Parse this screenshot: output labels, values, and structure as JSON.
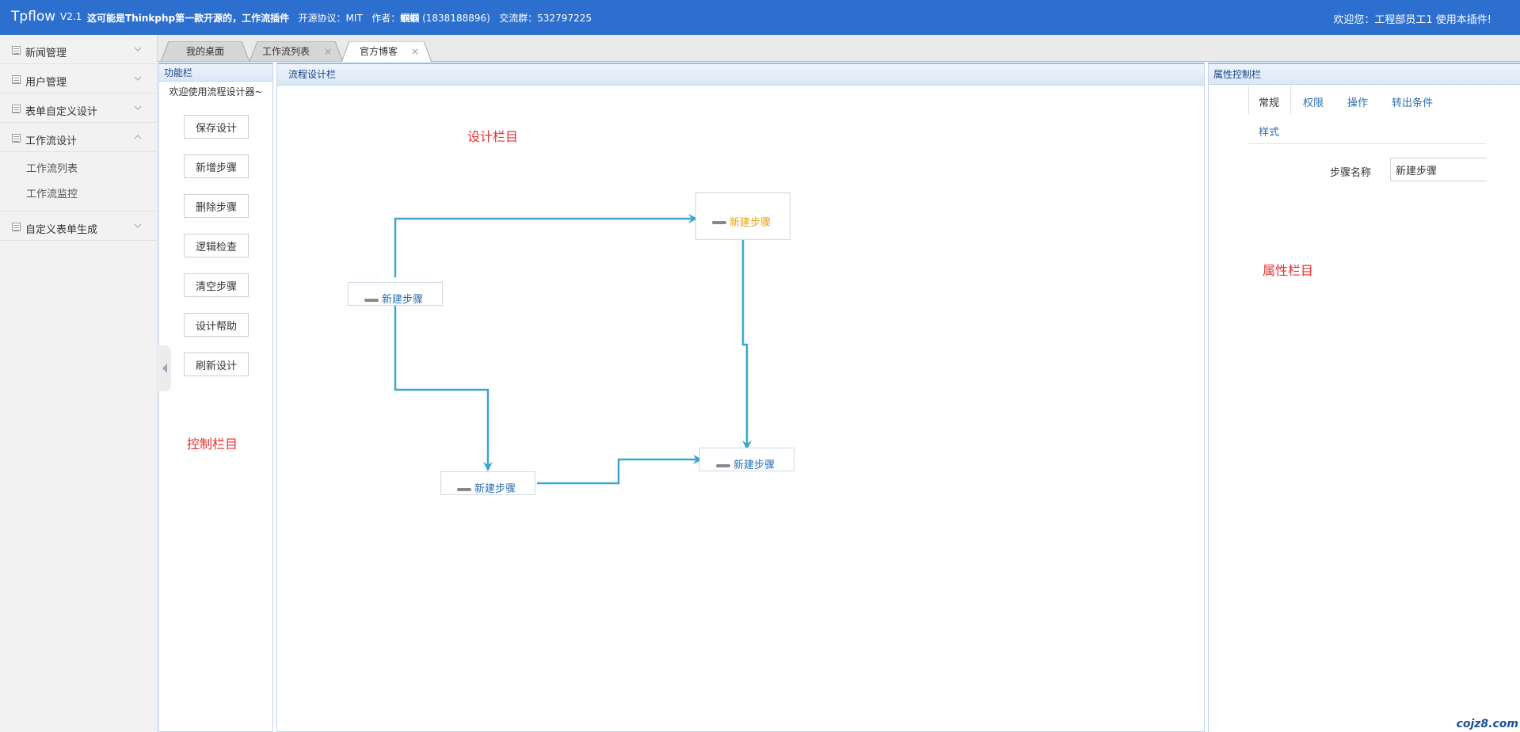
{
  "header": {
    "logo": "Tpflow",
    "version": "V2.1",
    "tagline": "这可能是Thinkphp第一款开源的，工作流插件",
    "license": "开源协议：MIT",
    "author_label": "作者：",
    "author_name": "蝈蝈",
    "author_contact": "(1838188896)",
    "group": "交流群：532797225",
    "welcome": "欢迎您：工程部员工1 使用本插件!"
  },
  "sidebar": {
    "items": [
      {
        "label": "新闻管理",
        "expanded": false
      },
      {
        "label": "用户管理",
        "expanded": false
      },
      {
        "label": "表单自定义设计",
        "expanded": false
      },
      {
        "label": "工作流设计",
        "expanded": true,
        "children": [
          "工作流列表",
          "工作流监控"
        ]
      },
      {
        "label": "自定义表单生成",
        "expanded": false
      }
    ]
  },
  "tabs": [
    {
      "label": "我的桌面",
      "closable": false,
      "active": false
    },
    {
      "label": "工作流列表",
      "closable": true,
      "active": false
    },
    {
      "label": "官方博客",
      "closable": true,
      "active": true
    }
  ],
  "tab_close_glyph": "×",
  "function_panel": {
    "title": "功能栏",
    "welcome": "欢迎使用流程设计器~",
    "buttons": [
      "保存设计",
      "新增步骤",
      "删除步骤",
      "逻辑检查",
      "清空步骤",
      "设计帮助",
      "刷新设计"
    ],
    "note": "控制栏目"
  },
  "design_panel": {
    "title": "流程设计栏",
    "note": "设计栏目",
    "steps": [
      "新建步骤",
      "新建步骤",
      "新建步骤",
      "新建步骤"
    ],
    "selected_step_color": "#e8a317",
    "connector_color": "#3ba7cf"
  },
  "property_panel": {
    "title": "属性控制栏",
    "tabs": [
      "常规",
      "权限",
      "操作",
      "转出条件",
      "样式"
    ],
    "active_tab": "常规",
    "field_label": "步骤名称",
    "field_value": "新建步骤",
    "note": "属性栏目"
  },
  "watermark": "cojz8.com",
  "colors": {
    "header_bg": "#2d6fcf",
    "note_red": "#e8302f",
    "link_blue": "#2a6fb3"
  }
}
